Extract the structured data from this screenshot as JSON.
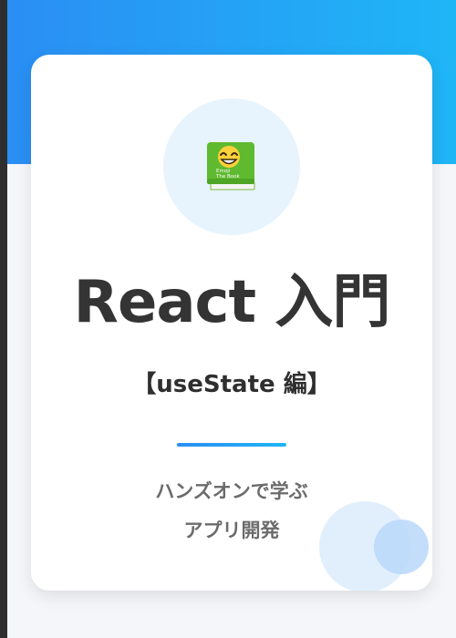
{
  "colors": {
    "accent_start": "#2a8ef4",
    "accent_end": "#1fb6f6",
    "title_text": "#343434",
    "tagline_text": "#6b6b6b",
    "icon_circle_bg": "#e7f4fd"
  },
  "icon": {
    "name": "emoji-book-icon",
    "book_text_line1": "Emoji",
    "book_text_line2": "The Book"
  },
  "card": {
    "title": "React 入門",
    "subtitle": "【useState 編】",
    "tagline_line1": "ハンズオンで学ぶ",
    "tagline_line2": "アプリ開発"
  }
}
